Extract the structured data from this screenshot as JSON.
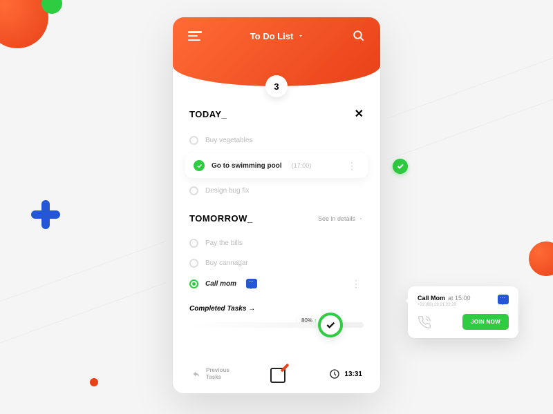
{
  "header": {
    "title": "To Do List",
    "badge": "3"
  },
  "today": {
    "title": "TODAY_",
    "tasks": [
      {
        "text": "Buy vegetables"
      },
      {
        "text": "Go to swimming pool",
        "time": "(17:00)"
      },
      {
        "text": "Design bug fix"
      }
    ]
  },
  "tomorrow": {
    "title": "TOMORROW_",
    "see_label": "See in details",
    "tasks": [
      {
        "text": "Pay the bills"
      },
      {
        "text": "Buy cannagar"
      },
      {
        "text": "Call mom"
      }
    ]
  },
  "completed_label": "Completed Tasks  →",
  "progress": "80%",
  "footer": {
    "prev": "Previous\nTasks",
    "time": "13:31"
  },
  "popup": {
    "title": "Call Mom",
    "at": "at 15:00",
    "sub": "+22 (98) 29 21 22 28",
    "cta": "JOIN NOW"
  }
}
